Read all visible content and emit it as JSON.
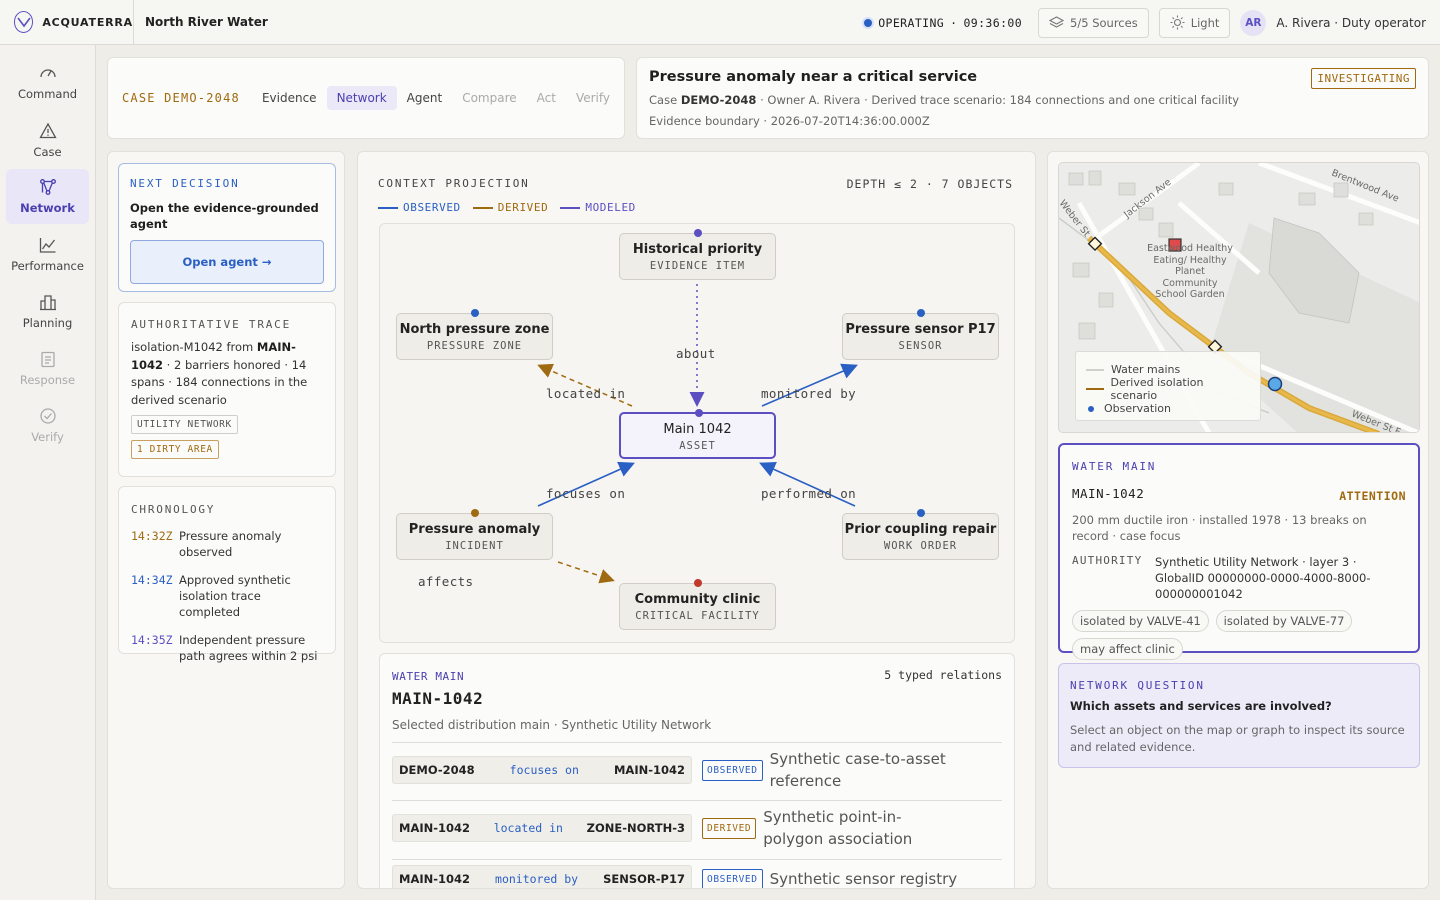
{
  "topbar": {
    "brand": "ACQUATERRA",
    "org": "North River Water",
    "status": "OPERATING",
    "time": "09:36:00",
    "sources": "5/5 Sources",
    "theme": "Light",
    "avatar": "AR",
    "user": "A. Rivera · Duty operator"
  },
  "nav": [
    {
      "label": "Command",
      "icon": "command-gauge-icon",
      "state": "normal"
    },
    {
      "label": "Case",
      "icon": "warning-triangle-icon",
      "state": "normal"
    },
    {
      "label": "Network",
      "icon": "network-graph-icon",
      "state": "active"
    },
    {
      "label": "Performance",
      "icon": "line-chart-icon",
      "state": "normal"
    },
    {
      "label": "Planning",
      "icon": "buildings-icon",
      "state": "normal"
    },
    {
      "label": "Response",
      "icon": "clipboard-icon",
      "state": "disabled"
    },
    {
      "label": "Verify",
      "icon": "check-circle-icon",
      "state": "disabled"
    }
  ],
  "case_header": {
    "case_id": "CASE DEMO-2048",
    "tabs": [
      {
        "label": "Evidence",
        "state": "normal"
      },
      {
        "label": "Network",
        "state": "active"
      },
      {
        "label": "Agent",
        "state": "normal"
      },
      {
        "label": "Compare",
        "state": "disabled"
      },
      {
        "label": "Act",
        "state": "disabled"
      },
      {
        "label": "Verify",
        "state": "disabled"
      }
    ]
  },
  "summary": {
    "title": "Pressure anomaly near a critical service",
    "badge": "INVESTIGATING",
    "case_prefix": "Case",
    "case_id": "DEMO-2048",
    "case_rest": "· Owner A. Rivera · Derived trace scenario: 184 connections and one critical facility",
    "boundary": "Evidence boundary · 2026-07-20T14:36:00.000Z"
  },
  "next_decision": {
    "kicker": "NEXT DECISION",
    "text": "Open the evidence-grounded agent",
    "button": "Open agent →"
  },
  "trace": {
    "kicker": "AUTHORITATIVE TRACE",
    "p1": "isolation-M1042 from ",
    "main": "MAIN-1042",
    "p2": " · 2 barriers honored · 14 spans · 184 connections in the derived scenario",
    "tag1": "UTILITY NETWORK",
    "tag2": "1 DIRTY AREA"
  },
  "chronology": {
    "kicker": "CHRONOLOGY",
    "items": [
      {
        "time": "14:32Z",
        "text": "Pressure anomaly observed",
        "color": "#a06a10"
      },
      {
        "time": "14:34Z",
        "text": "Approved synthetic isolation trace completed",
        "color": "#2a5fc4"
      },
      {
        "time": "14:35Z",
        "text": "Independent pressure path agrees within 2 psi",
        "color": "#5b4fc2"
      }
    ]
  },
  "context": {
    "title": "CONTEXT PROJECTION",
    "depth": "DEPTH ≤ 2 · 7 OBJECTS",
    "legend": [
      {
        "label": "OBSERVED",
        "color": "#2a5fc4"
      },
      {
        "label": "DERIVED",
        "color": "#a06a10"
      },
      {
        "label": "MODELED",
        "color": "#5b4fc2"
      }
    ],
    "nodes": {
      "historical": {
        "title": "Historical priority",
        "sub": "EVIDENCE ITEM",
        "pin": "#5b4fc2"
      },
      "zone": {
        "title": "North pressure zone",
        "sub": "PRESSURE ZONE",
        "pin": "#2a5fc4"
      },
      "sensor": {
        "title": "Pressure sensor P17",
        "sub": "SENSOR",
        "pin": "#2a5fc4"
      },
      "main": {
        "title": "Main 1042",
        "sub": "ASSET",
        "pin": "#5b4fc2"
      },
      "anomaly": {
        "title": "Pressure anomaly",
        "sub": "INCIDENT",
        "pin": "#a06a10"
      },
      "repair": {
        "title": "Prior coupling repair",
        "sub": "WORK ORDER",
        "pin": "#2a5fc4"
      },
      "clinic": {
        "title": "Community clinic",
        "sub": "CRITICAL FACILITY",
        "pin": "#c0392b"
      }
    },
    "edges": {
      "about": "about",
      "located_in": "located in",
      "monitored_by": "monitored by",
      "focuses_on": "focuses on",
      "performed_on": "performed on",
      "affects": "affects"
    }
  },
  "detail": {
    "kicker": "WATER MAIN",
    "title": "MAIN-1042",
    "count": "5 typed relations",
    "desc": "Selected distribution main · Synthetic Utility Network",
    "relations": [
      {
        "from": "DEMO-2048",
        "verb": "focuses on",
        "to": "MAIN-1042",
        "kind": "OBSERVED",
        "text": "Synthetic case-to-asset reference"
      },
      {
        "from": "MAIN-1042",
        "verb": "located in",
        "to": "ZONE-NORTH-3",
        "kind": "DERIVED",
        "text": "Synthetic point-in-polygon association"
      },
      {
        "from": "MAIN-1042",
        "verb": "monitored by",
        "to": "SENSOR-P17",
        "kind": "OBSERVED",
        "text": "Synthetic sensor registry"
      }
    ]
  },
  "map": {
    "streets": [
      "Jackson Ave",
      "Brentwood Ave",
      "Weber St",
      "Weber St F"
    ],
    "poi": "Eastwood Healthy Eating/ Healthy Planet Community School Garden",
    "legend": [
      {
        "label": "Water mains",
        "color": "#d0d0cc"
      },
      {
        "label": "Derived isolation scenario",
        "color": "#a06a10"
      },
      {
        "label": "Observation",
        "color": "#2a5fc4"
      }
    ]
  },
  "water_main": {
    "kicker": "WATER MAIN",
    "id": "MAIN-1042",
    "status": "ATTENTION",
    "meta": "200 mm ductile iron · installed 1978 · 13 breaks on record · case focus",
    "authority_label": "AUTHORITY",
    "authority": "Synthetic Utility Network · layer 3 · GlobalID 00000000-0000-4000-8000-000000001042",
    "chips": [
      "isolated by VALVE-41",
      "isolated by VALVE-77",
      "may affect clinic"
    ]
  },
  "network_question": {
    "kicker": "NETWORK QUESTION",
    "question": "Which assets and services are involved?",
    "hint": "Select an object on the map or graph to inspect its source and related evidence."
  }
}
